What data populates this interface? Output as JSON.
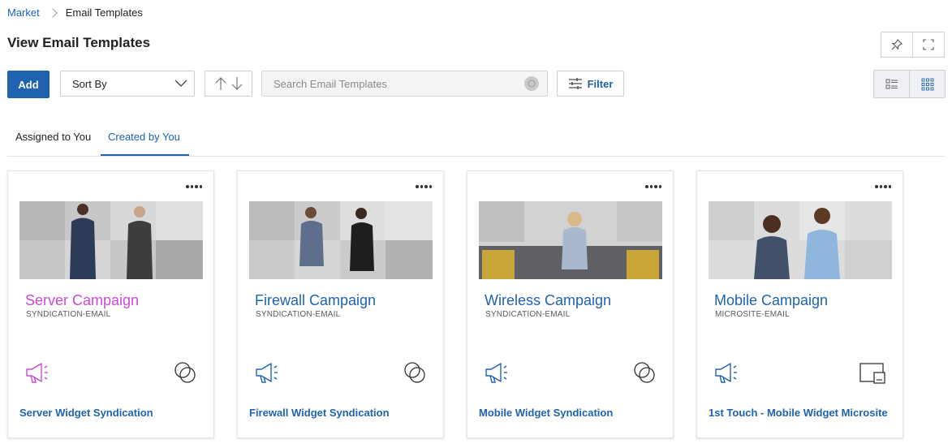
{
  "breadcrumb": {
    "parent": "Market",
    "current": "Email Templates"
  },
  "page": {
    "title": "View Email Templates"
  },
  "toolbar": {
    "add_label": "Add",
    "sort_label": "Sort By",
    "search_placeholder": "Search Email Templates",
    "filter_label": "Filter"
  },
  "tabs": [
    {
      "label": "Assigned to You",
      "active": false
    },
    {
      "label": "Created by You",
      "active": true
    }
  ],
  "colors": {
    "accent": "#1f63b0",
    "highlight": "#c94ad6"
  },
  "cards": [
    {
      "title": "Server Campaign",
      "subtitle": "SYNDICATION-EMAIL",
      "widget": "Server Widget Syndication",
      "channel_icon": "syndication-icon",
      "title_color": "#c94ad6"
    },
    {
      "title": "Firewall Campaign",
      "subtitle": "SYNDICATION-EMAIL",
      "widget": "Firewall Widget Syndication",
      "channel_icon": "syndication-icon",
      "title_color": "#1f63b0"
    },
    {
      "title": "Wireless Campaign",
      "subtitle": "SYNDICATION-EMAIL",
      "widget": "Mobile Widget Syndication",
      "channel_icon": "syndication-icon",
      "title_color": "#1f63b0"
    },
    {
      "title": "Mobile Campaign",
      "subtitle": "MICROSITE-EMAIL",
      "widget": "1st Touch - Mobile Widget Microsite",
      "channel_icon": "microsite-icon",
      "title_color": "#1f63b0"
    }
  ]
}
